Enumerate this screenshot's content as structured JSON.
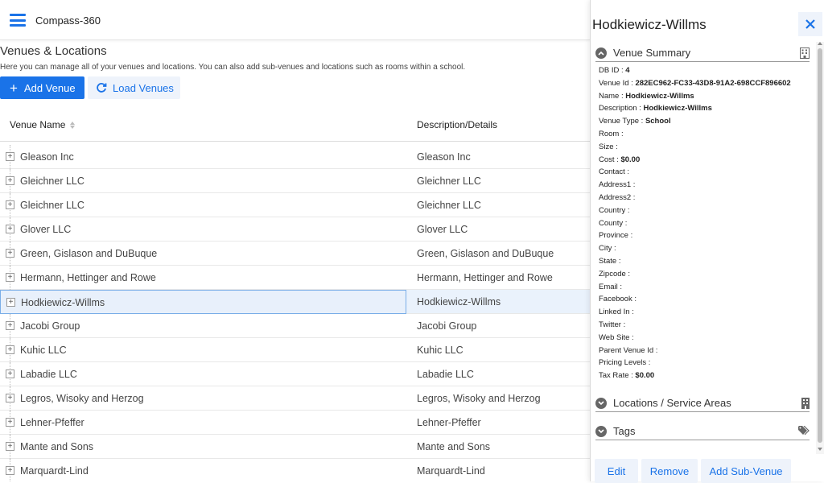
{
  "app": {
    "title": "Compass-360"
  },
  "page": {
    "title": "Venues & Locations",
    "subtitle": "Here you can manage all of your venues and locations. You can also add sub-venues and locations such as rooms within a school."
  },
  "toolbar": {
    "add_label": "Add Venue",
    "load_label": "Load Venues"
  },
  "grid": {
    "headers": {
      "name": "Venue Name",
      "description": "Description/Details"
    },
    "rows": [
      {
        "name": "Gleason Inc",
        "description": "Gleason Inc"
      },
      {
        "name": "Gleichner LLC",
        "description": "Gleichner LLC"
      },
      {
        "name": "Gleichner LLC",
        "description": "Gleichner LLC"
      },
      {
        "name": "Glover LLC",
        "description": "Glover LLC"
      },
      {
        "name": "Green, Gislason and DuBuque",
        "description": "Green, Gislason and DuBuque"
      },
      {
        "name": "Hermann, Hettinger and Rowe",
        "description": "Hermann, Hettinger and Rowe"
      },
      {
        "name": "Hodkiewicz-Willms",
        "description": "Hodkiewicz-Willms",
        "selected": true
      },
      {
        "name": "Jacobi Group",
        "description": "Jacobi Group"
      },
      {
        "name": "Kuhic LLC",
        "description": "Kuhic LLC"
      },
      {
        "name": "Labadie LLC",
        "description": "Labadie LLC"
      },
      {
        "name": "Legros, Wisoky and Herzog",
        "description": "Legros, Wisoky and Herzog"
      },
      {
        "name": "Lehner-Pfeffer",
        "description": "Lehner-Pfeffer"
      },
      {
        "name": "Mante and Sons",
        "description": "Mante and Sons"
      },
      {
        "name": "Marquardt-Lind",
        "description": "Marquardt-Lind"
      }
    ]
  },
  "panel": {
    "title": "Hodkiewicz-Willms",
    "sections": {
      "summary": "Venue Summary",
      "locations": "Locations / Service Areas",
      "tags": "Tags"
    },
    "fields": [
      {
        "label": "DB ID :",
        "value": "4"
      },
      {
        "label": "Venue Id :",
        "value": "282EC962-FC33-43D8-91A2-698CCF896602"
      },
      {
        "label": "Name :",
        "value": "Hodkiewicz-Willms"
      },
      {
        "label": "Description :",
        "value": "Hodkiewicz-Willms"
      },
      {
        "label": "Venue Type :",
        "value": "School"
      },
      {
        "label": "Room :",
        "value": ""
      },
      {
        "label": "Size :",
        "value": ""
      },
      {
        "label": "Cost :",
        "value": "$0.00"
      },
      {
        "label": "Contact :",
        "value": ""
      },
      {
        "label": "Address1 :",
        "value": ""
      },
      {
        "label": "Address2 :",
        "value": ""
      },
      {
        "label": "Country :",
        "value": ""
      },
      {
        "label": "County :",
        "value": ""
      },
      {
        "label": "Province :",
        "value": ""
      },
      {
        "label": "City :",
        "value": ""
      },
      {
        "label": "State :",
        "value": ""
      },
      {
        "label": "Zipcode :",
        "value": ""
      },
      {
        "label": "Email :",
        "value": ""
      },
      {
        "label": "Facebook :",
        "value": ""
      },
      {
        "label": "Linked In :",
        "value": ""
      },
      {
        "label": "Twitter :",
        "value": ""
      },
      {
        "label": "Web Site :",
        "value": ""
      },
      {
        "label": "Parent Venue Id :",
        "value": ""
      },
      {
        "label": "Pricing Levels :",
        "value": ""
      },
      {
        "label": "Tax Rate :",
        "value": "$0.00"
      }
    ],
    "actions": {
      "edit": "Edit",
      "remove": "Remove",
      "add_sub": "Add Sub-Venue"
    }
  },
  "colors": {
    "accent": "#1a73e8",
    "selected_row": "#eaf2fc",
    "button_light": "#eef3fb"
  },
  "icons": {
    "menu": "hamburger-icon",
    "add": "plus-icon",
    "load": "refresh-icon",
    "sort": "sort-icon",
    "expand": "expand-plus-icon",
    "close": "close-icon",
    "collapse": "chevron-up-icon",
    "summary": "building-icon",
    "locations": "building-icon",
    "tags": "tags-icon"
  }
}
